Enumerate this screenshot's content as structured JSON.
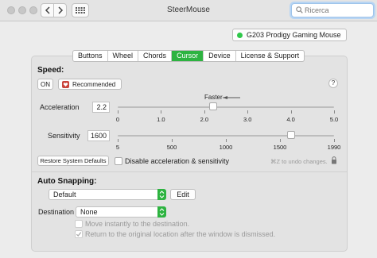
{
  "window": {
    "title": "SteerMouse"
  },
  "search": {
    "placeholder": "Ricerca"
  },
  "device": {
    "name": "G203 Prodigy Gaming Mouse",
    "status_color": "#2fc84a"
  },
  "tabs": [
    {
      "label": "Buttons"
    },
    {
      "label": "Wheel"
    },
    {
      "label": "Chords"
    },
    {
      "label": "Cursor"
    },
    {
      "label": "Device"
    },
    {
      "label": "License & Support"
    }
  ],
  "speed": {
    "title": "Speed:",
    "on_label": "ON",
    "preset_label": "Recommended",
    "help": "?",
    "faster_label": "Faster",
    "acceleration": {
      "label": "Acceleration",
      "value": "2.2",
      "ticks": [
        "0",
        "1.0",
        "2.0",
        "3.0",
        "4.0",
        "5.0"
      ],
      "level": 2.2
    },
    "sensitivity": {
      "label": "Sensitivity",
      "value": "1600",
      "ticks": [
        "5",
        "500",
        "1000",
        "1500",
        "1990"
      ],
      "level": 1600
    },
    "restore_label": "Restore System Defaults",
    "disable_label": "Disable acceleration & sensitivity",
    "undo_hint": "⌘Z to undo changes."
  },
  "snapping": {
    "title": "Auto Snapping:",
    "preset": "Default",
    "edit_label": "Edit",
    "destination_label": "Destination",
    "destination_value": "None",
    "move_instantly": "Move instantly to the destination.",
    "return_original": "Return to the original location after the window is dismissed."
  },
  "colors": {
    "accent": "#2db340"
  }
}
